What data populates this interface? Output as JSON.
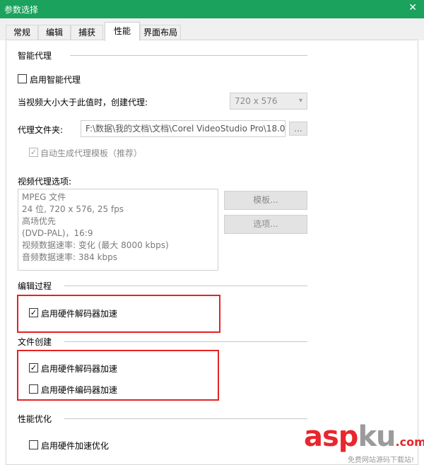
{
  "window": {
    "title": "参数选择"
  },
  "tabs": [
    {
      "label": "常规"
    },
    {
      "label": "编辑"
    },
    {
      "label": "捕获"
    },
    {
      "label": "性能"
    },
    {
      "label": "界面布局"
    }
  ],
  "smart_proxy": {
    "heading": "智能代理",
    "enable_label": "启用智能代理",
    "threshold_label": "当视频大小大于此值时，创建代理:",
    "threshold_value": "720 x 576",
    "folder_label": "代理文件夹:",
    "folder_path": "F:\\数据\\我的文档\\文档\\Corel VideoStudio Pro\\18.0\\",
    "browse_label": "...",
    "auto_template_label": "自动生成代理模板（推荐）"
  },
  "video_proxy_options": {
    "heading": "视频代理选项:",
    "lines": [
      "MPEG 文件",
      "24 位, 720 x 576, 25 fps",
      "高场优先",
      "(DVD-PAL)，16:9",
      "视频数据速率: 变化 (最大  8000 kbps)",
      "音频数据速率: 384 kbps"
    ],
    "template_button": "模板...",
    "options_button": "选项..."
  },
  "editing": {
    "heading": "编辑过程",
    "hw_decoder_label": "启用硬件解码器加速"
  },
  "file_creation": {
    "heading": "文件创建",
    "hw_decoder_label": "启用硬件解码器加速",
    "hw_encoder_label": "启用硬件编码器加速"
  },
  "optimization": {
    "heading": "性能优化",
    "hw_accel_label": "启用硬件加速优化"
  },
  "watermark": {
    "left": "asp",
    "right": "ku",
    "suffix": ".com",
    "subtitle": "免费网站源码下载站!"
  },
  "colors": {
    "titlebar": "#1ba25d",
    "highlight": "#e52222"
  }
}
